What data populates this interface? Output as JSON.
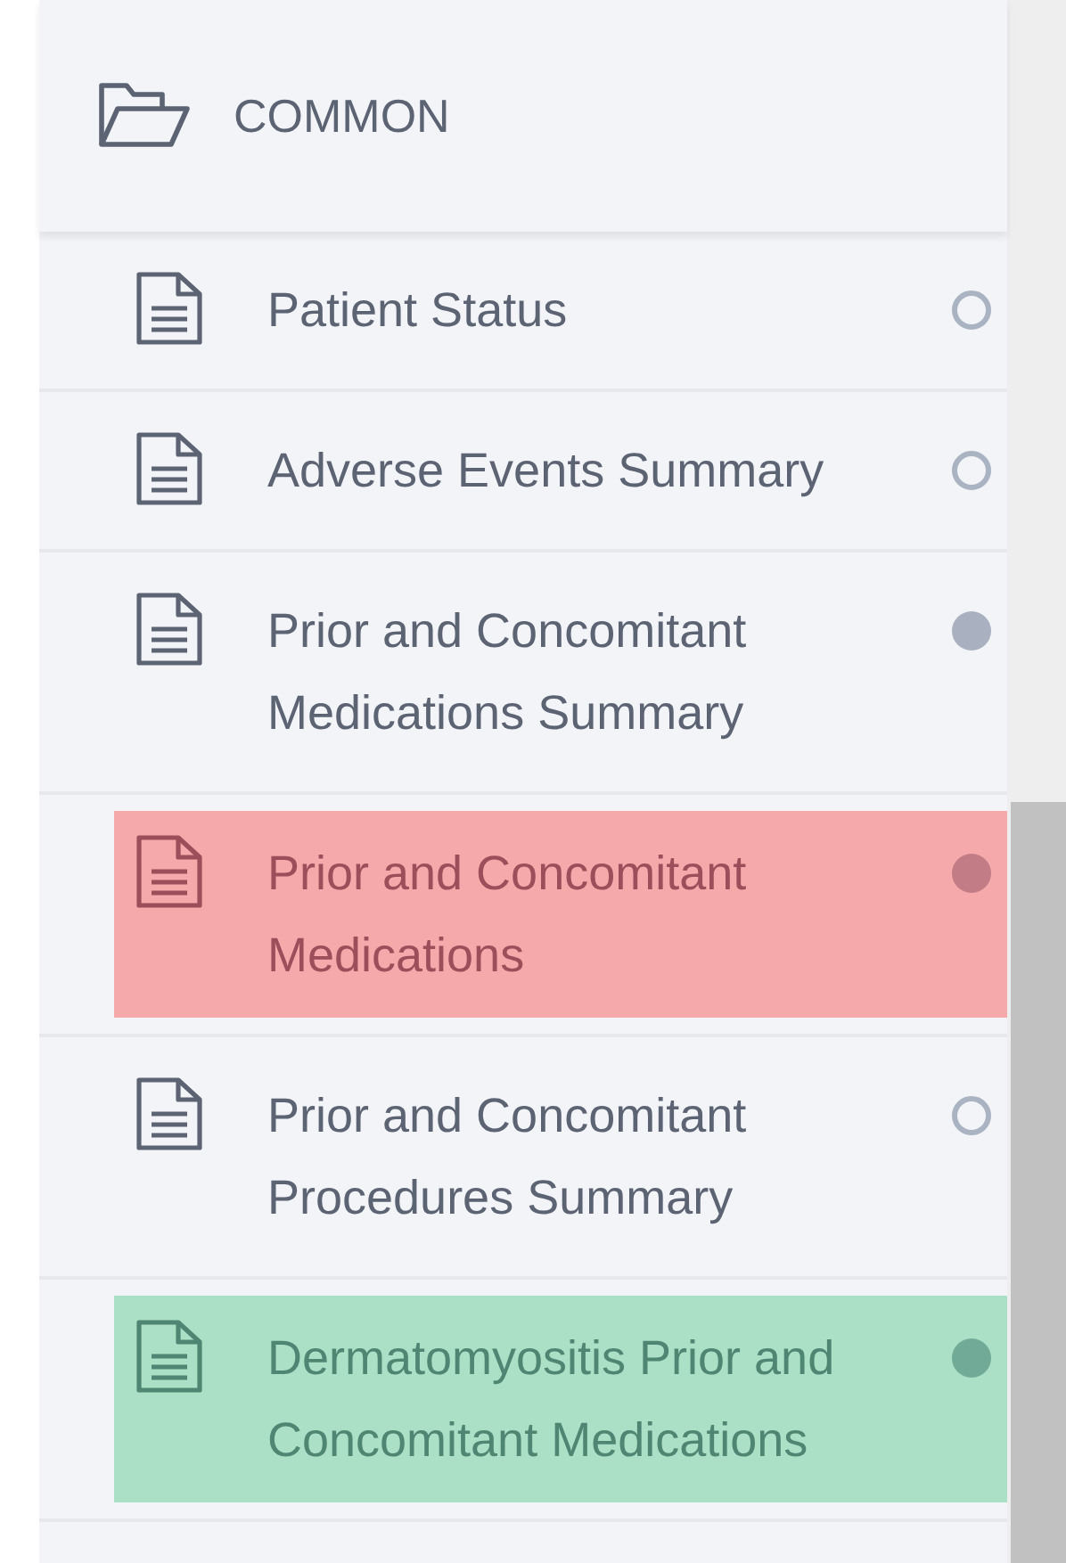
{
  "section": {
    "title": "COMMON",
    "expanded": true
  },
  "forms": [
    {
      "label": "Patient Status",
      "kind": "empty"
    },
    {
      "label": "Adverse Events Summary",
      "kind": "empty"
    },
    {
      "label": "Prior and Concomitant Medications Summary",
      "kind": "partial"
    },
    {
      "label": "Prior and Concomitant Medications",
      "kind": "error"
    },
    {
      "label": "Prior and Concomitant Procedures Summary",
      "kind": "empty"
    },
    {
      "label": "Dermatomyositis Prior and Concomitant Medications",
      "kind": "complete"
    }
  ]
}
